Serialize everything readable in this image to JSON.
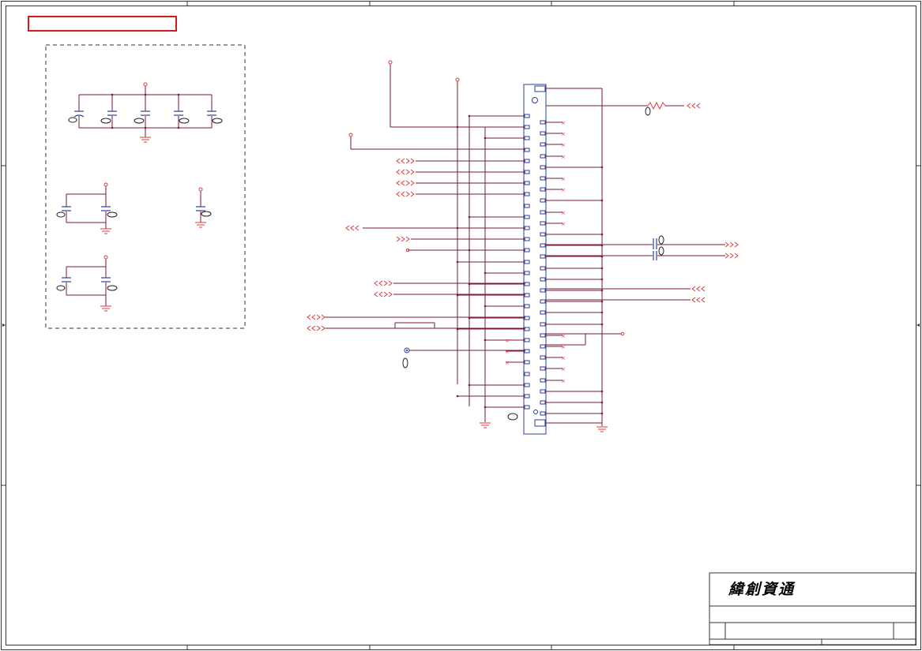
{
  "schematic": {
    "title_block": {
      "company": "緯創資通"
    },
    "colors": {
      "wire": "#7a1a3a",
      "net_label": "#e03a3a",
      "component": "#2b3f9e",
      "border": "#333333",
      "highlight_box": "#d01c1c"
    },
    "connector": {
      "left_pin_count": 27,
      "right_pin_count": 27
    },
    "icons": [
      "capacitor-symbol",
      "ground-symbol",
      "resistor-symbol",
      "offpage-arrow-symbol",
      "no-connect-marker",
      "test-point-symbol"
    ]
  }
}
